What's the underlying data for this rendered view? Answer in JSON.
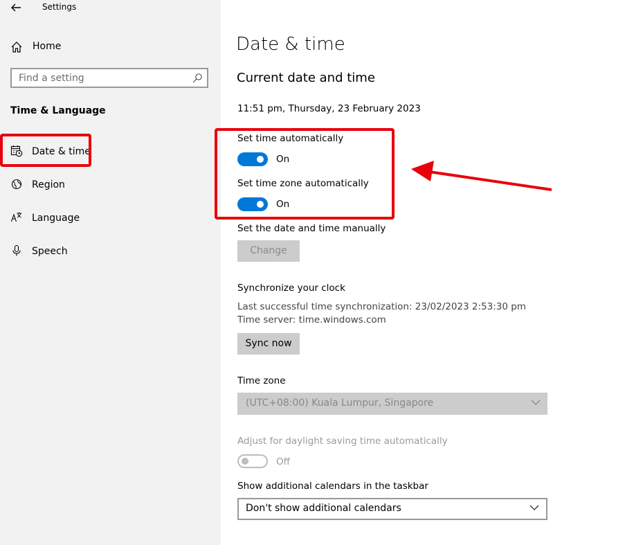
{
  "window": {
    "title": "Settings"
  },
  "sidebar": {
    "home_label": "Home",
    "search_placeholder": "Find a setting",
    "section_title": "Time & Language",
    "items": [
      {
        "label": "Date & time",
        "icon": "calendar-clock-icon",
        "selected": true
      },
      {
        "label": "Region",
        "icon": "globe-icon"
      },
      {
        "label": "Language",
        "icon": "language-icon"
      },
      {
        "label": "Speech",
        "icon": "microphone-icon"
      }
    ]
  },
  "main": {
    "title": "Date & time",
    "subtitle": "Current date and time",
    "current_datetime": "11:51 pm, Thursday, 23 February 2023",
    "set_time_auto": {
      "label": "Set time automatically",
      "state": "On",
      "on": true
    },
    "set_timezone_auto": {
      "label": "Set time zone automatically",
      "state": "On",
      "on": true
    },
    "manual": {
      "label": "Set the date and time manually",
      "button": "Change"
    },
    "sync": {
      "heading": "Synchronize your clock",
      "last_sync": "Last successful time synchronization: 23/02/2023 2:53:30 pm",
      "server": "Time server: time.windows.com",
      "button": "Sync now"
    },
    "timezone": {
      "label": "Time zone",
      "value": "(UTC+08:00) Kuala Lumpur, Singapore"
    },
    "dst": {
      "label": "Adjust for daylight saving time automatically",
      "state": "Off",
      "on": false
    },
    "calendars": {
      "label": "Show additional calendars in the taskbar",
      "value": "Don't show additional calendars"
    }
  },
  "annotation": {
    "color": "#e8000b"
  },
  "colors": {
    "accent": "#0078d7",
    "sidebar_bg": "#f2f2f2",
    "button_bg": "#cccccc"
  }
}
